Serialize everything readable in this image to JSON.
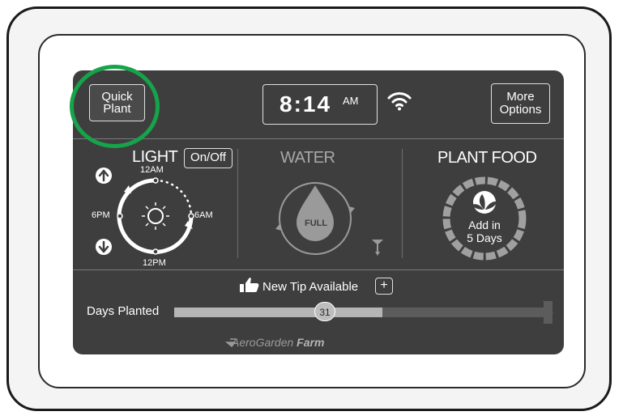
{
  "header": {
    "quick_plant_line1": "Quick",
    "quick_plant_line2": "Plant",
    "time": "8:14",
    "ampm": "AM",
    "more_options_line1": "More",
    "more_options_line2": "Options",
    "wifi_icon": "wifi-icon"
  },
  "light": {
    "title": "LIGHT",
    "toggle_label": "On/Off",
    "labels": {
      "top": "12AM",
      "right": "6AM",
      "bottom": "12PM",
      "left": "6PM"
    },
    "icons": [
      "arrow-up-icon",
      "arrow-down-icon",
      "sun-icon"
    ]
  },
  "water": {
    "title": "WATER",
    "level_label": "FULL",
    "icons": [
      "water-drop-icon",
      "faucet-icon"
    ]
  },
  "plant_food": {
    "title": "PLANT FOOD",
    "line1": "Add in",
    "line2": "5 Days",
    "icons": [
      "leaf-icon"
    ]
  },
  "tip": {
    "label": "New Tip Available",
    "plus": "+",
    "icons": [
      "thumbs-up-icon"
    ]
  },
  "days": {
    "label": "Days Planted",
    "value": "31",
    "progress": 0.55
  },
  "brand": {
    "name": "AeroGarden",
    "model": "Farm"
  },
  "colors": {
    "screen_bg": "#3e3e3e",
    "highlight": "#16a34a"
  }
}
